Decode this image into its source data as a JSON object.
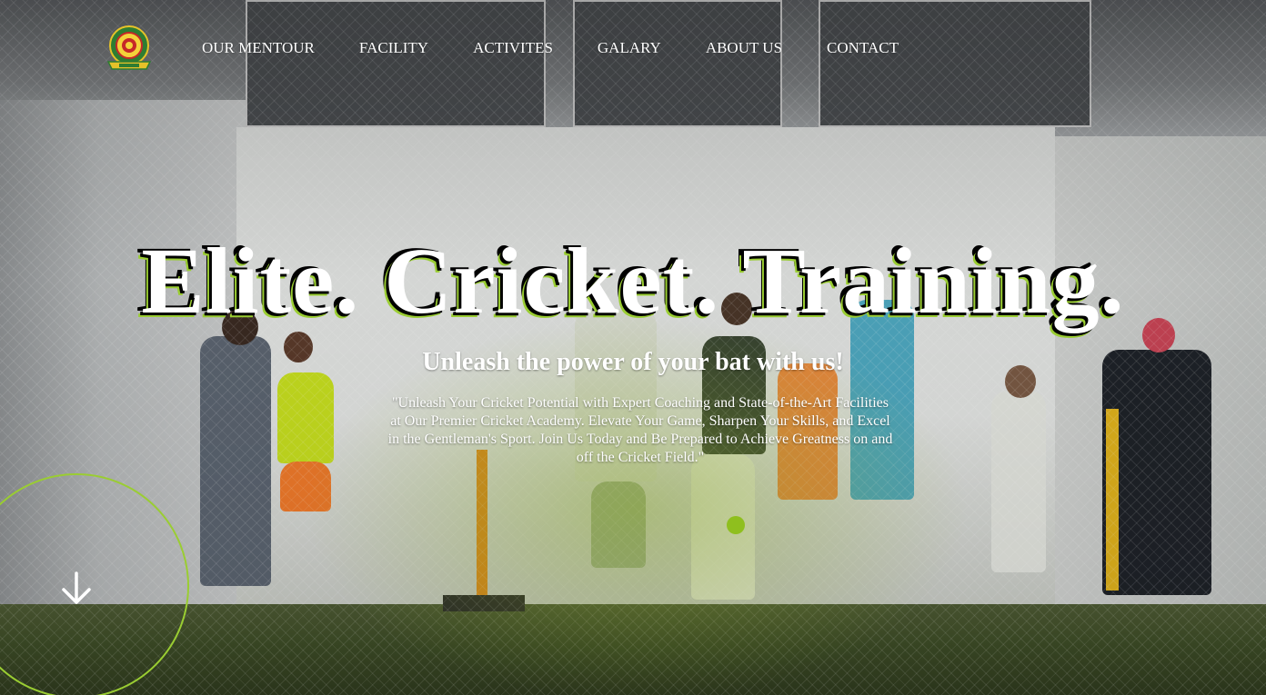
{
  "brand": {
    "logo_icon": "academy-crest-logo"
  },
  "nav": {
    "items": [
      {
        "label": "OUR MENTOUR"
      },
      {
        "label": "FACILITY"
      },
      {
        "label": "ACTIVITES"
      },
      {
        "label": "GALARY"
      },
      {
        "label": "ABOUT US"
      },
      {
        "label": "CONTACT"
      }
    ]
  },
  "hero": {
    "headline": "Elite. Cricket. Training.",
    "subheadline": "Unleash the power of your bat with us!",
    "description": "\"Unleash Your Cricket Potential with Expert Coaching and State-of-the-Art Facilities at Our Premier Cricket Academy. Elevate Your Game, Sharpen Your Skills, and Excel in the Gentleman's Sport. Join Us Today and Be Prepared to Achieve Greatness on and off the Cricket Field.\"",
    "scroll_icon": "arrow-down-icon",
    "slider_dot_icon": "slider-dot-icon"
  },
  "colors": {
    "accent": "#9acd32",
    "dot": "#8fbf1e",
    "text": "#ffffff"
  }
}
